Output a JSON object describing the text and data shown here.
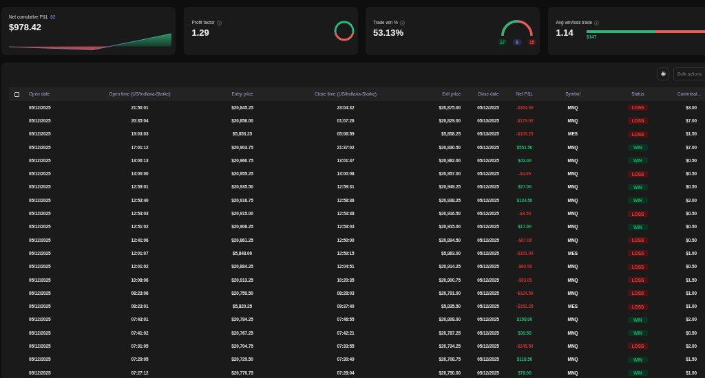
{
  "summary_cards": [
    {
      "kind": "sparkline",
      "title": "Net cumulative P&L",
      "badge": "32",
      "value": "$978.42"
    },
    {
      "kind": "ring",
      "title": "Profit factor",
      "info": true,
      "value": "1.29"
    },
    {
      "kind": "gauge",
      "title": "Trade win %",
      "info": true,
      "value": "53.13%",
      "level": 0.53,
      "counts": [
        {
          "label": "17",
          "kind": "win"
        },
        {
          "label": "0",
          "kind": "even"
        },
        {
          "label": "15",
          "kind": "loss"
        }
      ]
    },
    {
      "kind": "bar",
      "title": "Avg win/loss trade",
      "info": true,
      "value": "1.14",
      "level": 0.58,
      "bar_label": "$147"
    }
  ],
  "toolbar": {
    "bulk_actions": {
      "label": "Bulk actions",
      "disabled": true
    }
  },
  "table": {
    "select_all": {
      "checked": false
    },
    "columns": [
      "Open date",
      "Open time (US/Indiana-Starke)",
      "Entry price",
      "Close time (US/Indiana-Starke)",
      "Exit price",
      "Close date",
      "Net P&L",
      "Symbol",
      "Status",
      "Commissi..."
    ],
    "rows": [
      {
        "open_date": "05/12/2025",
        "open_time": "21:50:01",
        "entry_price": "$20,845.25",
        "close_time": "23:04:32",
        "exit_price": "$20,875.00",
        "close_date": "05/12/2025",
        "net_pnl": "-$364.00",
        "symbol": "MNQ",
        "status": {
          "label": "LOSS",
          "kind": "loss"
        },
        "commission": "$3.00"
      },
      {
        "open_date": "05/12/2025",
        "open_time": "20:35:04",
        "entry_price": "$20,856.00",
        "close_time": "01:07:26",
        "exit_price": "$20,829.00",
        "close_date": "05/13/2025",
        "net_pnl": "-$179.00",
        "symbol": "MNQ",
        "status": {
          "label": "LOSS",
          "kind": "loss"
        },
        "commission": "$7.00"
      },
      {
        "open_date": "05/12/2025",
        "open_time": "19:03:03",
        "entry_price": "$5,853.25",
        "close_time": "05:06:59",
        "exit_price": "$5,858.25",
        "close_date": "05/13/2025",
        "net_pnl": "-$105.25",
        "symbol": "MES",
        "status": {
          "label": "LOSS",
          "kind": "loss"
        },
        "commission": "$1.50"
      },
      {
        "open_date": "05/12/2025",
        "open_time": "17:01:12",
        "entry_price": "$20,903.75",
        "close_time": "21:37:02",
        "exit_price": "$20,830.50",
        "close_date": "05/12/2025",
        "net_pnl": "$551.50",
        "symbol": "MNQ",
        "status": {
          "label": "WIN",
          "kind": "win"
        },
        "commission": "$7.00"
      },
      {
        "open_date": "05/12/2025",
        "open_time": "13:00:13",
        "entry_price": "$20,960.75",
        "close_time": "13:01:47",
        "exit_price": "$20,982.00",
        "close_date": "05/12/2025",
        "net_pnl": "$42.00",
        "symbol": "MNQ",
        "status": {
          "label": "WIN",
          "kind": "win"
        },
        "commission": "$0.50"
      },
      {
        "open_date": "05/12/2025",
        "open_time": "13:00:00",
        "entry_price": "$20,955.25",
        "close_time": "13:00:08",
        "exit_price": "$20,957.00",
        "close_date": "05/12/2025",
        "net_pnl": "-$4.00",
        "symbol": "MNQ",
        "status": {
          "label": "LOSS",
          "kind": "loss"
        },
        "commission": "$0.50"
      },
      {
        "open_date": "05/12/2025",
        "open_time": "12:59:01",
        "entry_price": "$20,935.50",
        "close_time": "12:59:31",
        "exit_price": "$20,949.25",
        "close_date": "05/12/2025",
        "net_pnl": "$27.00",
        "symbol": "MNQ",
        "status": {
          "label": "WIN",
          "kind": "win"
        },
        "commission": "$0.50"
      },
      {
        "open_date": "05/12/2025",
        "open_time": "12:53:40",
        "entry_price": "$20,916.75",
        "close_time": "12:58:36",
        "exit_price": "$20,938.25",
        "close_date": "05/12/2025",
        "net_pnl": "$134.50",
        "symbol": "MNQ",
        "status": {
          "label": "WIN",
          "kind": "win"
        },
        "commission": "$2.00"
      },
      {
        "open_date": "05/12/2025",
        "open_time": "12:53:03",
        "entry_price": "$20,915.00",
        "close_time": "12:53:38",
        "exit_price": "$20,916.50",
        "close_date": "05/12/2025",
        "net_pnl": "-$3.50",
        "symbol": "MNQ",
        "status": {
          "label": "LOSS",
          "kind": "loss"
        },
        "commission": "$0.50"
      },
      {
        "open_date": "05/12/2025",
        "open_time": "12:51:02",
        "entry_price": "$20,906.25",
        "close_time": "12:53:03",
        "exit_price": "$20,915.00",
        "close_date": "05/12/2025",
        "net_pnl": "$17.00",
        "symbol": "MNQ",
        "status": {
          "label": "WIN",
          "kind": "win"
        },
        "commission": "$0.50"
      },
      {
        "open_date": "05/12/2025",
        "open_time": "12:41:06",
        "entry_price": "$20,861.25",
        "close_time": "12:50:00",
        "exit_price": "$20,894.50",
        "close_date": "05/12/2025",
        "net_pnl": "-$67.00",
        "symbol": "MNQ",
        "status": {
          "label": "LOSS",
          "kind": "loss"
        },
        "commission": "$0.50"
      },
      {
        "open_date": "05/12/2025",
        "open_time": "12:01:07",
        "entry_price": "$5,848.00",
        "close_time": "12:59:15",
        "exit_price": "$5,863.00",
        "close_date": "05/12/2025",
        "net_pnl": "-$151.00",
        "symbol": "MES",
        "status": {
          "label": "LOSS",
          "kind": "loss"
        },
        "commission": "$1.00"
      },
      {
        "open_date": "05/12/2025",
        "open_time": "12:01:02",
        "entry_price": "$20,884.25",
        "close_time": "12:04:51",
        "exit_price": "$20,914.25",
        "close_date": "05/12/2025",
        "net_pnl": "-$60.50",
        "symbol": "MNQ",
        "status": {
          "label": "LOSS",
          "kind": "loss"
        },
        "commission": "$0.50"
      },
      {
        "open_date": "05/12/2025",
        "open_time": "10:08:06",
        "entry_price": "$20,913.25",
        "close_time": "10:20:35",
        "exit_price": "$20,900.75",
        "close_date": "05/12/2025",
        "net_pnl": "-$83.00",
        "symbol": "MNQ",
        "status": {
          "label": "LOSS",
          "kind": "loss"
        },
        "commission": "$1.50"
      },
      {
        "open_date": "05/12/2025",
        "open_time": "08:23:06",
        "entry_price": "$20,759.50",
        "close_time": "08:28:03",
        "exit_price": "$20,791.00",
        "close_date": "05/12/2025",
        "net_pnl": "-$124.50",
        "symbol": "MNQ",
        "status": {
          "label": "LOSS",
          "kind": "loss"
        },
        "commission": "$1.00"
      },
      {
        "open_date": "05/12/2025",
        "open_time": "08:23:01",
        "entry_price": "$5,820.25",
        "close_time": "09:37:40",
        "exit_price": "$5,835.50",
        "close_date": "05/12/2025",
        "net_pnl": "-$152.25",
        "symbol": "MES",
        "status": {
          "label": "LOSS",
          "kind": "loss"
        },
        "commission": "$1.00"
      },
      {
        "open_date": "05/12/2025",
        "open_time": "07:43:01",
        "entry_price": "$20,784.25",
        "close_time": "07:46:55",
        "exit_price": "$20,808.00",
        "close_date": "05/12/2025",
        "net_pnl": "$158.00",
        "symbol": "MNQ",
        "status": {
          "label": "WIN",
          "kind": "win"
        },
        "commission": "$2.00"
      },
      {
        "open_date": "05/12/2025",
        "open_time": "07:41:02",
        "entry_price": "$20,767.25",
        "close_time": "07:42:21",
        "exit_price": "$20,787.25",
        "close_date": "05/12/2025",
        "net_pnl": "$39.50",
        "symbol": "MNQ",
        "status": {
          "label": "WIN",
          "kind": "win"
        },
        "commission": "$0.50"
      },
      {
        "open_date": "05/12/2025",
        "open_time": "07:31:05",
        "entry_price": "$20,704.75",
        "close_time": "07:33:55",
        "exit_price": "$20,734.25",
        "close_date": "05/12/2025",
        "net_pnl": "-$245.50",
        "symbol": "MNQ",
        "status": {
          "label": "LOSS",
          "kind": "loss"
        },
        "commission": "$2.00"
      },
      {
        "open_date": "05/12/2025",
        "open_time": "07:29:05",
        "entry_price": "$20,729.50",
        "close_time": "07:30:49",
        "exit_price": "$20,708.75",
        "close_date": "05/12/2025",
        "net_pnl": "$118.50",
        "symbol": "MNQ",
        "status": {
          "label": "WIN",
          "kind": "win"
        },
        "commission": "$1.50"
      },
      {
        "open_date": "05/12/2025",
        "open_time": "07:27:12",
        "entry_price": "$20,770.75",
        "close_time": "07:28:04",
        "exit_price": "$20,750.00",
        "close_date": "05/12/2025",
        "net_pnl": "$78.00",
        "symbol": "MNQ",
        "status": {
          "label": "WIN",
          "kind": "win"
        },
        "commission": "$1.00"
      }
    ]
  }
}
